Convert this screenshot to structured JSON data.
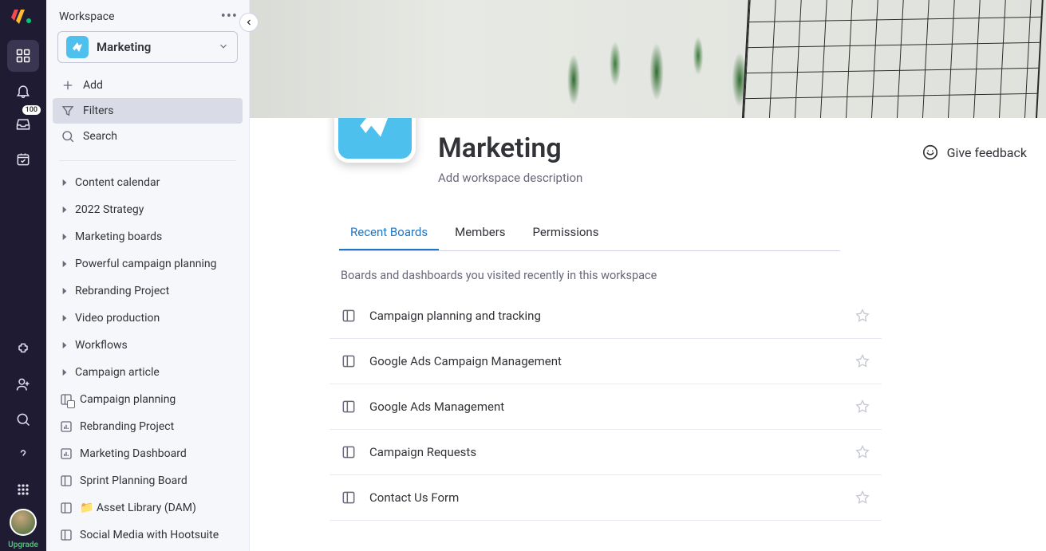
{
  "rail": {
    "notifications_badge": "100",
    "upgrade_label": "Upgrade"
  },
  "panel": {
    "workspace_label": "Workspace",
    "selected_workspace": "Marketing",
    "actions": {
      "add": "Add",
      "filters": "Filters",
      "search": "Search"
    },
    "folders": [
      "Content calendar",
      "2022 Strategy",
      "Marketing boards",
      "Powerful campaign planning",
      "Rebranding Project",
      "Video production",
      "Workflows",
      "Campaign article"
    ],
    "boards": [
      {
        "name": "Campaign planning",
        "icon": "board-private"
      },
      {
        "name": "Rebranding Project",
        "icon": "dashboard"
      },
      {
        "name": "Marketing Dashboard",
        "icon": "dashboard"
      },
      {
        "name": "Sprint Planning Board",
        "icon": "board"
      },
      {
        "name": "📁 Asset Library (DAM)",
        "icon": "board"
      },
      {
        "name": "Social Media with Hootsuite",
        "icon": "board"
      }
    ]
  },
  "workspace": {
    "title": "Marketing",
    "description_placeholder": "Add workspace description",
    "feedback_label": "Give feedback",
    "tabs": [
      "Recent Boards",
      "Members",
      "Permissions"
    ],
    "active_tab": 0,
    "hint": "Boards and dashboards you visited recently in this workspace",
    "recent_boards": [
      "Campaign planning and tracking",
      "Google Ads Campaign Management",
      "Google Ads Management",
      "Campaign Requests",
      "Contact Us Form"
    ]
  }
}
